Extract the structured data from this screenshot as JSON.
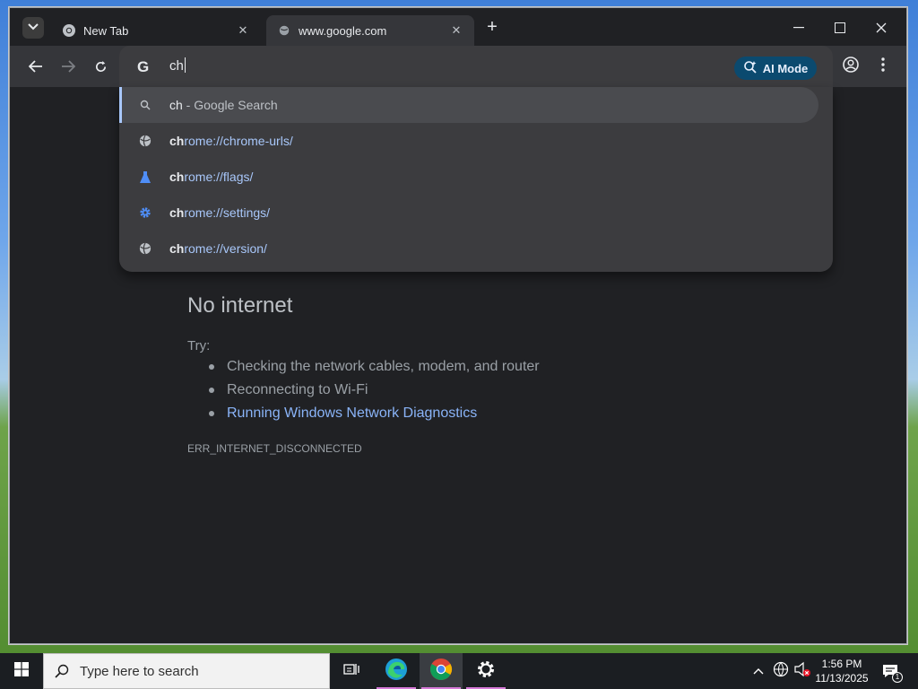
{
  "tabs": [
    {
      "title": "New Tab",
      "favicon": "chrome-icon",
      "active": false
    },
    {
      "title": "www.google.com",
      "favicon": "globe-icon",
      "active": true
    }
  ],
  "omnibox": {
    "logo": "G",
    "text": "ch",
    "ai_mode_label": "AI Mode"
  },
  "suggestions": [
    {
      "icon": "search-icon",
      "bold": "ch",
      "rest": "",
      "sep": " - ",
      "tail": "Google Search",
      "selected": true
    },
    {
      "icon": "globe-icon",
      "bold": "ch",
      "rest": "rome://chrome-urls/"
    },
    {
      "icon": "flask-icon",
      "bold": "ch",
      "rest": "rome://flags/"
    },
    {
      "icon": "gear-icon",
      "bold": "ch",
      "rest": "rome://settings/"
    },
    {
      "icon": "globe-icon",
      "bold": "ch",
      "rest": "rome://version/"
    }
  ],
  "page": {
    "title": "No internet",
    "try_label": "Try:",
    "tips": [
      "Checking the network cables, modem, and router",
      "Reconnecting to Wi-Fi",
      "Running Windows Network Diagnostics"
    ],
    "error_code": "ERR_INTERNET_DISCONNECTED"
  },
  "taskbar": {
    "search_placeholder": "Type here to search",
    "time": "1:56 PM",
    "date": "11/13/2025",
    "notification_count": "1"
  },
  "colors": {
    "link": "#8ab4f8",
    "ai_mode_bg": "#0b4a6f",
    "page_bg": "#202124"
  }
}
